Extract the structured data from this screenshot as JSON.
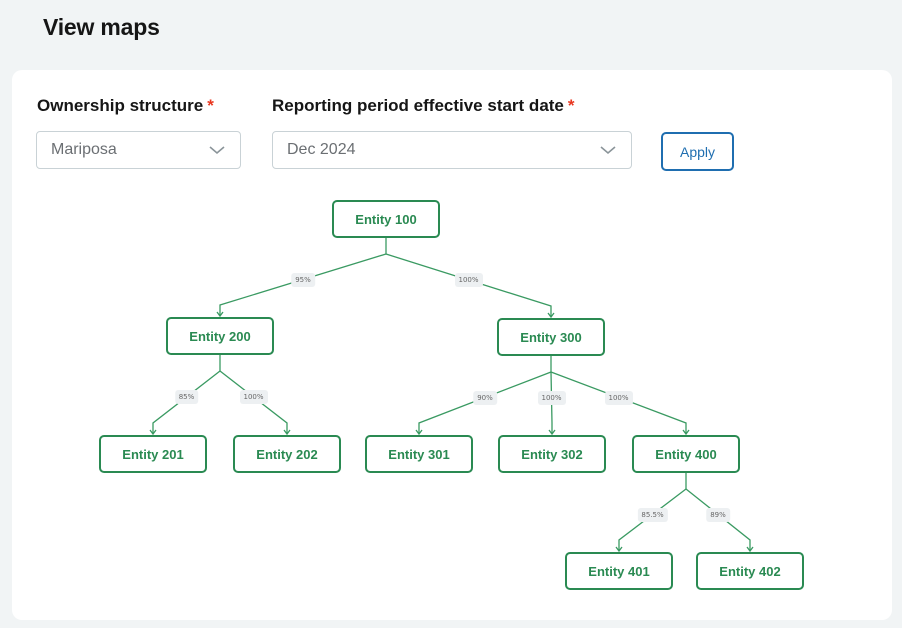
{
  "page": {
    "title": "View maps"
  },
  "filters": {
    "ownership_label": "Ownership structure",
    "ownership_required": "*",
    "ownership_value": "Mariposa",
    "period_label": "Reporting period effective start date",
    "period_required": "*",
    "period_value": "Dec 2024",
    "apply_label": "Apply"
  },
  "colors": {
    "node": "#2a8a52",
    "edge": "#3a9a62",
    "required": "#e8361f",
    "apply": "#1f6eb0"
  },
  "tree": {
    "nodes": [
      {
        "id": "e100",
        "label": "Entity 100"
      },
      {
        "id": "e200",
        "label": "Entity 200"
      },
      {
        "id": "e300",
        "label": "Entity 300"
      },
      {
        "id": "e201",
        "label": "Entity 201"
      },
      {
        "id": "e202",
        "label": "Entity 202"
      },
      {
        "id": "e301",
        "label": "Entity 301"
      },
      {
        "id": "e302",
        "label": "Entity 302"
      },
      {
        "id": "e400",
        "label": "Entity 400"
      },
      {
        "id": "e401",
        "label": "Entity 401"
      },
      {
        "id": "e402",
        "label": "Entity 402"
      }
    ],
    "edges": [
      {
        "from": "e100",
        "to": "e200",
        "label": "95%"
      },
      {
        "from": "e100",
        "to": "e300",
        "label": "100%"
      },
      {
        "from": "e200",
        "to": "e201",
        "label": "85%"
      },
      {
        "from": "e200",
        "to": "e202",
        "label": "100%"
      },
      {
        "from": "e300",
        "to": "e301",
        "label": "90%"
      },
      {
        "from": "e300",
        "to": "e302",
        "label": "100%"
      },
      {
        "from": "e300",
        "to": "e400",
        "label": "100%"
      },
      {
        "from": "e400",
        "to": "e401",
        "label": "85.5%"
      },
      {
        "from": "e400",
        "to": "e402",
        "label": "89%"
      }
    ]
  }
}
